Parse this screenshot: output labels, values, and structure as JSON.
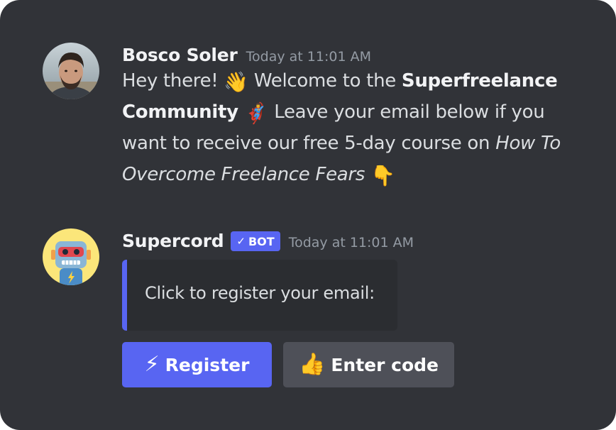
{
  "messages": [
    {
      "author": "Bosco Soler",
      "timestamp": "Today at 11:01 AM",
      "text_1": "Hey there!",
      "emoji_wave": "👋",
      "text_2": " Welcome to the ",
      "bold_text": "Superfreelance Community",
      "emoji_hero": "🦸‍♂️",
      "text_3": " Leave your email below if you want to receive our free 5-day course on ",
      "italic_text": "How To Overcome Freelance Fears",
      "emoji_point": "👇"
    },
    {
      "author": "Supercord",
      "bot_check": "✓",
      "bot_label": "BOT",
      "timestamp": "Today at 11:01 AM",
      "embed_description": "Click to register your email:",
      "buttons": [
        {
          "emoji": "⚡",
          "label": "Register"
        },
        {
          "emoji": "👍",
          "label": "Enter code"
        }
      ]
    }
  ],
  "colors": {
    "background": "#313338",
    "blurple": "#5865f2",
    "secondary_button": "#4e5058",
    "embed_background": "#2b2d31",
    "timestamp": "#949ba4"
  }
}
